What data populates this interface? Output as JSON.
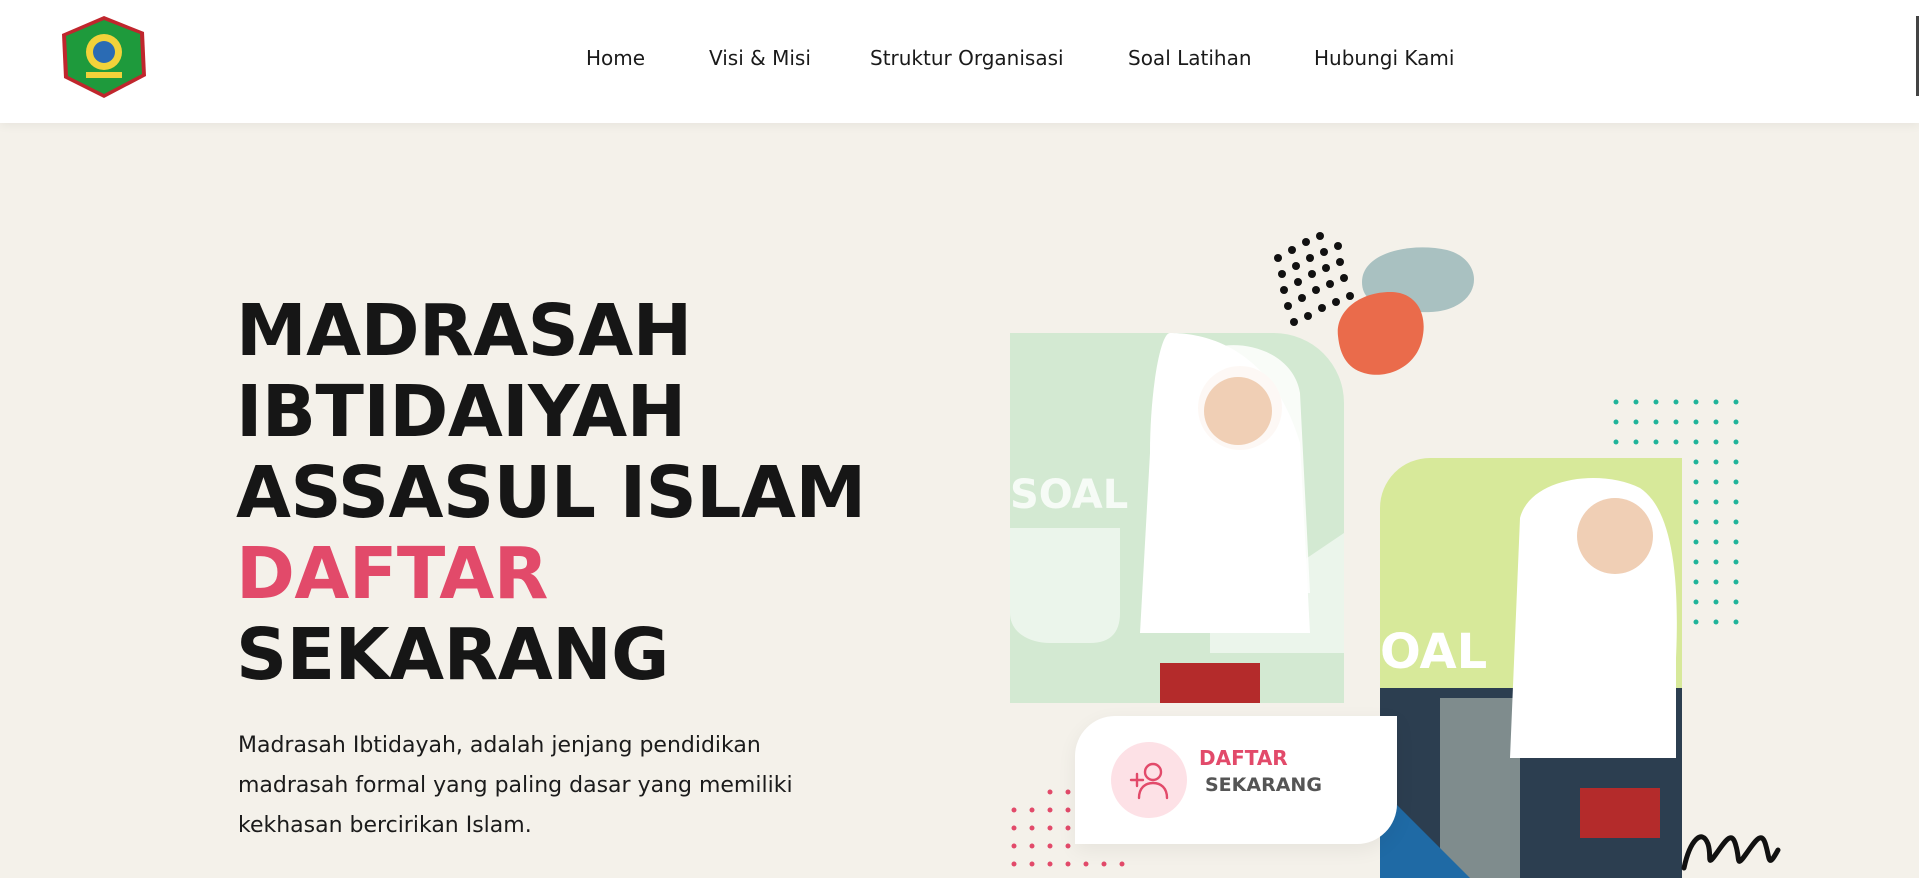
{
  "header": {
    "logo_name": "madrasah-logo",
    "nav": [
      {
        "label": "Home"
      },
      {
        "label": "Visi & Misi"
      },
      {
        "label": "Struktur Organisasi"
      },
      {
        "label": "Soal Latihan"
      },
      {
        "label": "Hubungi Kami"
      }
    ]
  },
  "hero": {
    "title_lines": [
      "MADRASAH",
      "IBTIDAIYAH",
      "ASSASUL ISLAM"
    ],
    "title_accent": "DAFTAR",
    "title_last": "SEKARANG",
    "description": "Madrasah Ibtidayah, adalah jenjang pendidikan madrasah formal yang paling dasar yang memiliki kekhasan bercirikan Islam."
  },
  "cta": {
    "line1": "DAFTAR",
    "line2": "SEKARANG",
    "icon": "add-user-icon"
  },
  "colors": {
    "accent": "#e24a6a",
    "background": "#f4f1ea",
    "teal": "#1fb39a",
    "orange": "#ea6b4b",
    "card_green": "#d3e9d2",
    "card_lime": "#d7e99a"
  }
}
